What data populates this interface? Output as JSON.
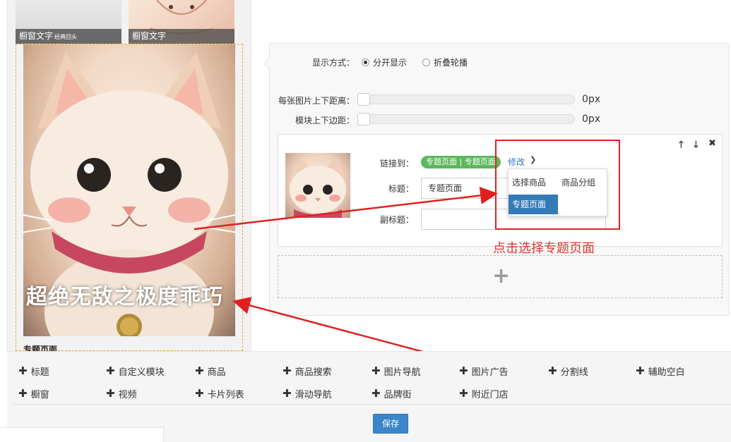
{
  "preview": {
    "thumb_captions": [
      "橱窗文字",
      "橱窗文字"
    ],
    "thumb_sub_caption": "经典回头",
    "banner_text": "超绝无敌之极度乖巧",
    "banner_title": "专题页面"
  },
  "settings": {
    "display_mode_label": "显示方式：",
    "display_options": [
      {
        "label": "分开显示",
        "selected": true
      },
      {
        "label": "折叠轮播",
        "selected": false
      }
    ],
    "image_spacing_label": "每张图片上下距离：",
    "image_spacing_value": "0px",
    "module_margin_label": "模块上下边距：",
    "module_margin_value": "0px"
  },
  "item": {
    "controls": {
      "up": "🡑",
      "down": "🡓",
      "close": "✖"
    },
    "link_label": "链接到：",
    "link_tag": "专题页面 | 专题页面",
    "modify_label": "修改",
    "title_label": "标题：",
    "title_value": "专题页面",
    "subtitle_label": "副标题：",
    "subtitle_value": "",
    "dropdown": {
      "options": [
        {
          "label": "选择商品",
          "active": false
        },
        {
          "label": "商品分组",
          "active": false
        },
        {
          "label": "专题页面",
          "active": true
        }
      ]
    }
  },
  "add_area": {
    "symbol": "+"
  },
  "annotation": {
    "hint": "点击选择专题页面",
    "color": "#e02020"
  },
  "toolbar": {
    "row1": [
      "标题",
      "自定义模块",
      "商品",
      "商品搜索",
      "图片导航",
      "图片广告",
      "分割线",
      "辅助空白"
    ],
    "row2": [
      "橱窗",
      "视频",
      "卡片列表",
      "滑动导航",
      "品牌街",
      "附近门店"
    ],
    "save_label": "保存"
  },
  "colors": {
    "accent": "#3a86c8",
    "link": "#337ab7",
    "tag": "#5cb85c",
    "highlight": "#e02020",
    "dashed_border": "#f0a81e"
  }
}
